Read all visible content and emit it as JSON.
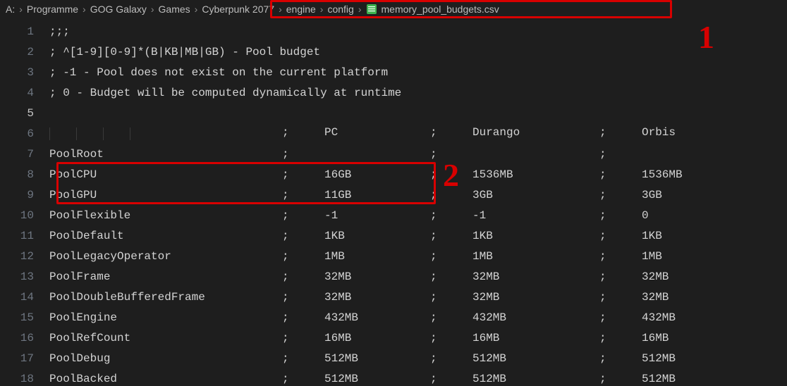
{
  "breadcrumb": {
    "drive": "A:",
    "parts": [
      "Programme",
      "GOG Galaxy",
      "Games",
      "Cyberpunk 2077",
      "engine",
      "config"
    ],
    "file": "memory_pool_budgets.csv"
  },
  "lines": {
    "l1": ";;;",
    "l2": "; ^[1-9][0-9]*(B|KB|MB|GB) - Pool budget",
    "l3": "; -1 - Pool does not exist on the current platform",
    "l4": "; 0 - Budget will be computed dynamically at runtime",
    "l5": ""
  },
  "columns": {
    "pc": "PC",
    "durango": "Durango",
    "orbis": "Orbis"
  },
  "sep": ";",
  "rows": [
    {
      "ln": 7,
      "name": "PoolRoot",
      "pc": "",
      "du": "",
      "or": ""
    },
    {
      "ln": 8,
      "name": "PoolCPU",
      "pc": "16GB",
      "du": "1536MB",
      "or": "1536MB"
    },
    {
      "ln": 9,
      "name": "PoolGPU",
      "pc": "11GB",
      "du": "3GB",
      "or": "3GB"
    },
    {
      "ln": 10,
      "name": "PoolFlexible",
      "pc": "-1",
      "du": "-1",
      "or": "0"
    },
    {
      "ln": 11,
      "name": "PoolDefault",
      "pc": "1KB",
      "du": "1KB",
      "or": "1KB"
    },
    {
      "ln": 12,
      "name": "PoolLegacyOperator",
      "pc": "1MB",
      "du": "1MB",
      "or": "1MB"
    },
    {
      "ln": 13,
      "name": "PoolFrame",
      "pc": "32MB",
      "du": "32MB",
      "or": "32MB"
    },
    {
      "ln": 14,
      "name": "PoolDoubleBufferedFrame",
      "pc": "32MB",
      "du": "32MB",
      "or": "32MB"
    },
    {
      "ln": 15,
      "name": "PoolEngine",
      "pc": "432MB",
      "du": "432MB",
      "or": "432MB"
    },
    {
      "ln": 16,
      "name": "PoolRefCount",
      "pc": "16MB",
      "du": "16MB",
      "or": "16MB"
    },
    {
      "ln": 17,
      "name": "PoolDebug",
      "pc": "512MB",
      "du": "512MB",
      "or": "512MB"
    },
    {
      "ln": 18,
      "name": "PoolBacked",
      "pc": "512MB",
      "du": "512MB",
      "or": "512MB"
    }
  ],
  "annotations": {
    "n1": "1",
    "n2": "2"
  }
}
